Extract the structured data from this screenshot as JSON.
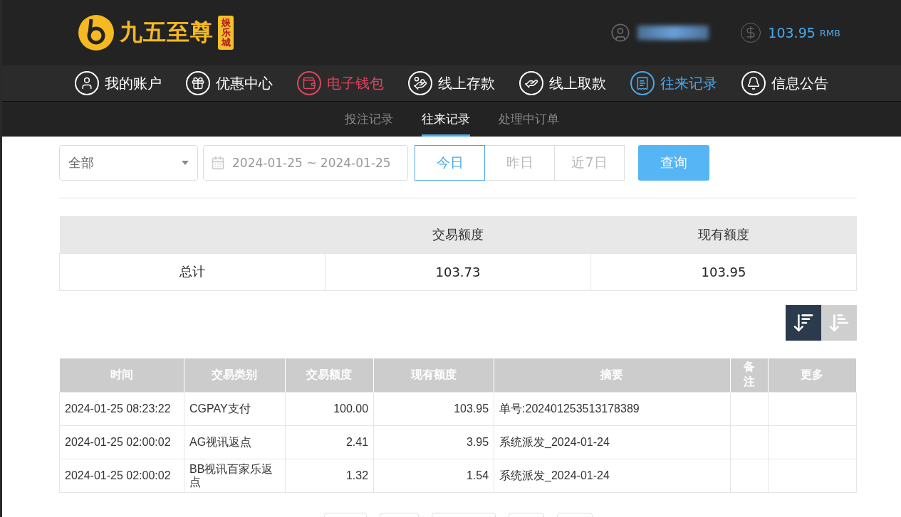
{
  "header": {
    "logo": {
      "main": "九五至尊",
      "tag": "娱乐城"
    },
    "balance": "103.95",
    "currency": "RMB"
  },
  "nav": [
    {
      "label": "我的账户",
      "kind": "user",
      "color": "#ffffff"
    },
    {
      "label": "优惠中心",
      "kind": "gift",
      "color": "#ffffff"
    },
    {
      "label": "电子钱包",
      "kind": "wallet",
      "color": "#e0455f"
    },
    {
      "label": "线上存款",
      "kind": "deposit",
      "color": "#ffffff"
    },
    {
      "label": "线上取款",
      "kind": "withdraw",
      "color": "#ffffff"
    },
    {
      "label": "往来记录",
      "kind": "records",
      "color": "#4ba8ea"
    },
    {
      "label": "信息公告",
      "kind": "bell",
      "color": "#ffffff"
    }
  ],
  "subtabs": [
    {
      "label": "投注记录",
      "selected": false
    },
    {
      "label": "往来记录",
      "selected": true
    },
    {
      "label": "处理中订单",
      "selected": false
    }
  ],
  "filter": {
    "type_select": "全部",
    "date_range": "2024-01-25 ~ 2024-01-25",
    "quick": [
      {
        "label": "今日",
        "selected": true
      },
      {
        "label": "昨日",
        "selected": false
      },
      {
        "label": "近7日",
        "selected": false
      }
    ],
    "query_button": "查询"
  },
  "summary": {
    "columns": [
      "交易额度",
      "现有额度"
    ],
    "row": {
      "label": "总计",
      "values": [
        "103.73",
        "103.95"
      ]
    }
  },
  "sort_buttons": [
    {
      "kind": "desc",
      "selected": true
    },
    {
      "kind": "asc",
      "selected": false
    }
  ],
  "table": {
    "columns": [
      "时间",
      "交易类别",
      "交易额度",
      "现有额度",
      "摘要",
      "备注",
      "更多"
    ],
    "rows": [
      [
        "2024-01-25 08:23:22",
        "CGPAY支付",
        "100.00",
        "103.95",
        "单号:202401253513178389",
        "",
        ""
      ],
      [
        "2024-01-25 02:00:02",
        "AG视讯返点",
        "2.41",
        "3.95",
        "系统派发_2024-01-24",
        "",
        ""
      ],
      [
        "2024-01-25 02:00:02",
        "BB视讯百家乐返点",
        "1.32",
        "1.54",
        "系统派发_2024-01-24",
        "",
        ""
      ]
    ]
  }
}
